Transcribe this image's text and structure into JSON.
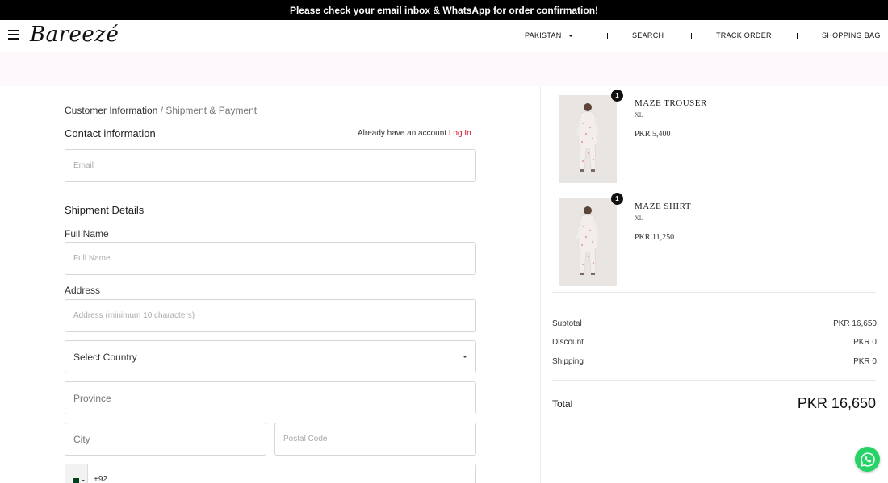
{
  "announcement": "Please check your email inbox & WhatsApp for order confirmation!",
  "header": {
    "logo": "Bareezé",
    "country": "PAKISTAN",
    "search": "SEARCH",
    "track_order": "TRACK ORDER",
    "shopping_bag": "SHOPPING BAG",
    "separator": "|"
  },
  "breadcrumb": {
    "step1": "Customer Information",
    "step2": " / Shipment & Payment"
  },
  "contact": {
    "title": "Contact information",
    "account_prompt": "Already have an account ",
    "login_label": "Log In",
    "email_placeholder": "Email"
  },
  "shipment": {
    "title": "Shipment Details",
    "full_name_label": "Full Name",
    "full_name_placeholder": "Full Name",
    "address_label": "Address",
    "address_placeholder": "Address (minimum 10 characters)",
    "country_select": "Select Country",
    "province_placeholder": "Province",
    "city_placeholder": "City",
    "postal_placeholder": "Postal Code",
    "phone_code": "+92"
  },
  "cart": {
    "items": [
      {
        "name": "MAZE TROUSER",
        "size": "XL",
        "price": "PKR 5,400",
        "qty": "1"
      },
      {
        "name": "MAZE SHIRT",
        "size": "XL",
        "price": "PKR 11,250",
        "qty": "1"
      }
    ],
    "subtotal_label": "Subtotal",
    "subtotal_value": "PKR 16,650",
    "discount_label": "Discount",
    "discount_value": "PKR 0",
    "shipping_label": "Shipping",
    "shipping_value": "PKR 0",
    "total_label": "Total",
    "total_value": "PKR 16,650"
  },
  "colors": {
    "accent_link": "#d0112b",
    "whatsapp": "#25d366",
    "announcement_bg": "#000000"
  },
  "icons": [
    "hamburger-menu-icon",
    "chevron-down-icon",
    "pakistan-flag-icon",
    "whatsapp-icon"
  ]
}
